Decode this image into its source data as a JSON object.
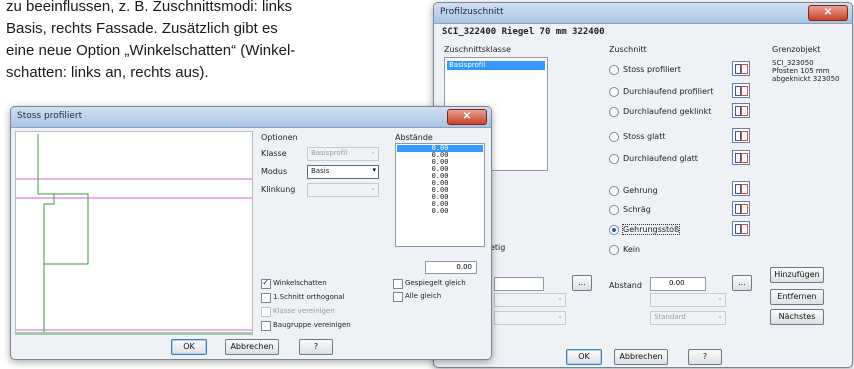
{
  "doc": {
    "lines": [
      "zu beeinflussen, z. B. Zuschnittsmodi: links",
      "Basis, rechts Fassade. Zusätzlich gibt es",
      "eine neue Option „Winkelschatten“ (Winkel-",
      "schatten: links an, rechts aus)."
    ]
  },
  "left_dialog": {
    "title": "Stoss profiliert",
    "options_header": "Optionen",
    "klasse_label": "Klasse",
    "klasse_value": "Basisprofil",
    "modus_label": "Modus",
    "modus_value": "Basis",
    "klinkung_label": "Klinkung",
    "klinkung_value": "",
    "abstaende_header": "Abstände",
    "values": [
      "0.00",
      "0.00",
      "0.00",
      "0.00",
      "0.00",
      "0.00",
      "0.00",
      "0.00",
      "0.00",
      "0.00"
    ],
    "abstand_input": "0.00",
    "checkboxes": [
      {
        "label": "Winkelschatten",
        "checked": true,
        "disabled": false
      },
      {
        "label": "1.Schnitt orthogonal",
        "checked": false,
        "disabled": false
      },
      {
        "label": "Klasse vereinigen",
        "checked": false,
        "disabled": true
      },
      {
        "label": "Baugruppe vereinigen",
        "checked": false,
        "disabled": false
      }
    ],
    "gespiegelt_label": "Gespiegelt gleich",
    "alle_gleich_label": "Alle gleich",
    "ok_label": "OK",
    "cancel_label": "Abbrechen",
    "help_label": "?"
  },
  "right_dialog": {
    "title": "Profilzuschnitt",
    "heading": "SCI_322400 Riegel 70 mm 322400",
    "class_group_label": "Zuschnittsklasse",
    "class_selected": "Basisprofil",
    "cut_header": "Zuschnitt",
    "options": [
      {
        "label": "Stoss profiliert",
        "selected": false
      },
      {
        "label": "Durchlaufend profiliert",
        "selected": false
      },
      {
        "label": "Durchlaufend geklinkt",
        "selected": false
      },
      {
        "label": "Stoss glatt",
        "selected": false
      },
      {
        "label": "Durchlaufend glatt",
        "selected": false
      },
      {
        "label": "Gehrung",
        "selected": false
      },
      {
        "label": "Schräg",
        "selected": false
      },
      {
        "label": "Gehrungsstoß",
        "selected": true
      },
      {
        "label": "Kein",
        "selected": false
      }
    ],
    "border_header": "Grenzobjekt",
    "border_lines": [
      "SCI_323050",
      "Pfosten 105 mm",
      "abgeknickt 323050"
    ],
    "partial_label": "etig",
    "abstand_label": "Abstand",
    "abstand_value": "0.00",
    "standard_value": "Standard",
    "more_button": "...",
    "add_label": "Hinzufügen",
    "remove_label": "Entfernen",
    "next_label": "Nächstes",
    "ok_label": "OK",
    "cancel_label": "Abbrechen",
    "help_label": "?"
  },
  "colors": {
    "accent": "#3399ff",
    "profile_green": "#3a9a3a",
    "profile_magenta": "#d060d0"
  }
}
